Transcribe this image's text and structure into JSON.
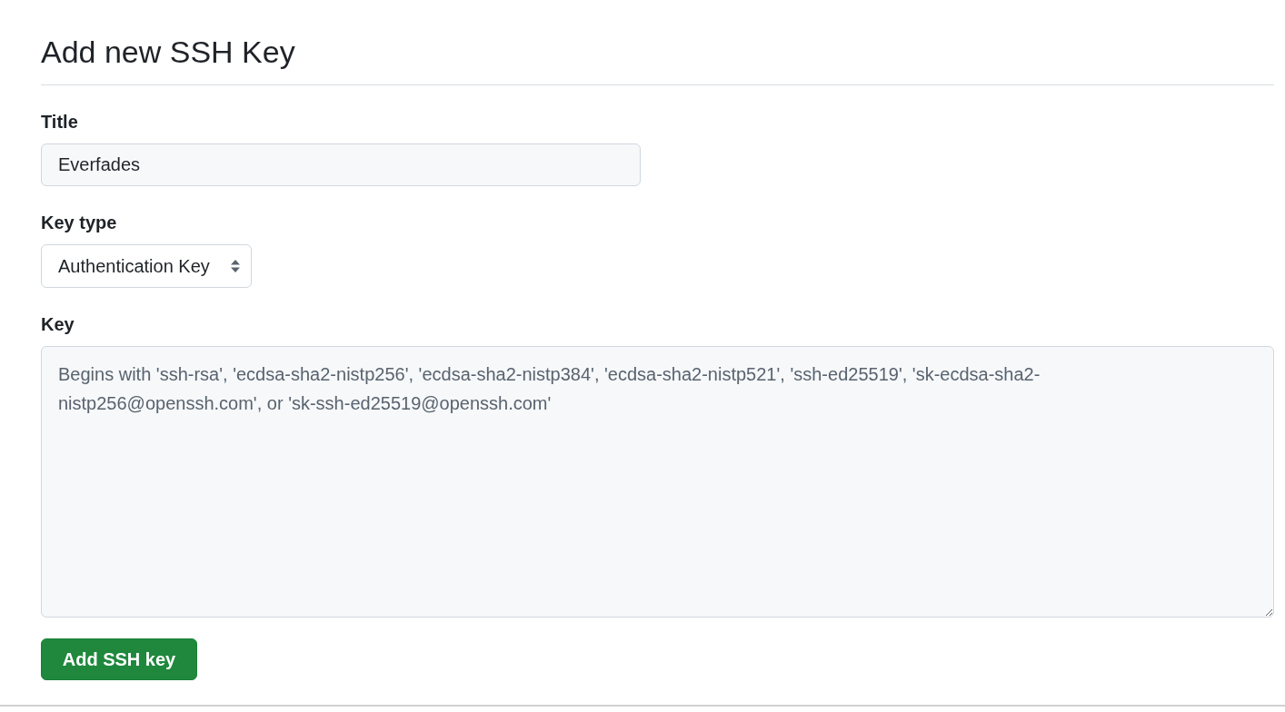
{
  "heading": "Add new SSH Key",
  "fields": [
    {
      "kind": "text",
      "label": "Title",
      "value": "Everfades"
    },
    {
      "kind": "select",
      "label": "Key type",
      "value": "Authentication Key"
    },
    {
      "kind": "textarea",
      "label": "Key",
      "placeholder": "Begins with 'ssh-rsa', 'ecdsa-sha2-nistp256', 'ecdsa-sha2-nistp384', 'ecdsa-sha2-nistp521', 'ssh-ed25519', 'sk-ecdsa-sha2-nistp256@openssh.com', or 'sk-ssh-ed25519@openssh.com'"
    }
  ],
  "submit_button": "Add SSH key"
}
